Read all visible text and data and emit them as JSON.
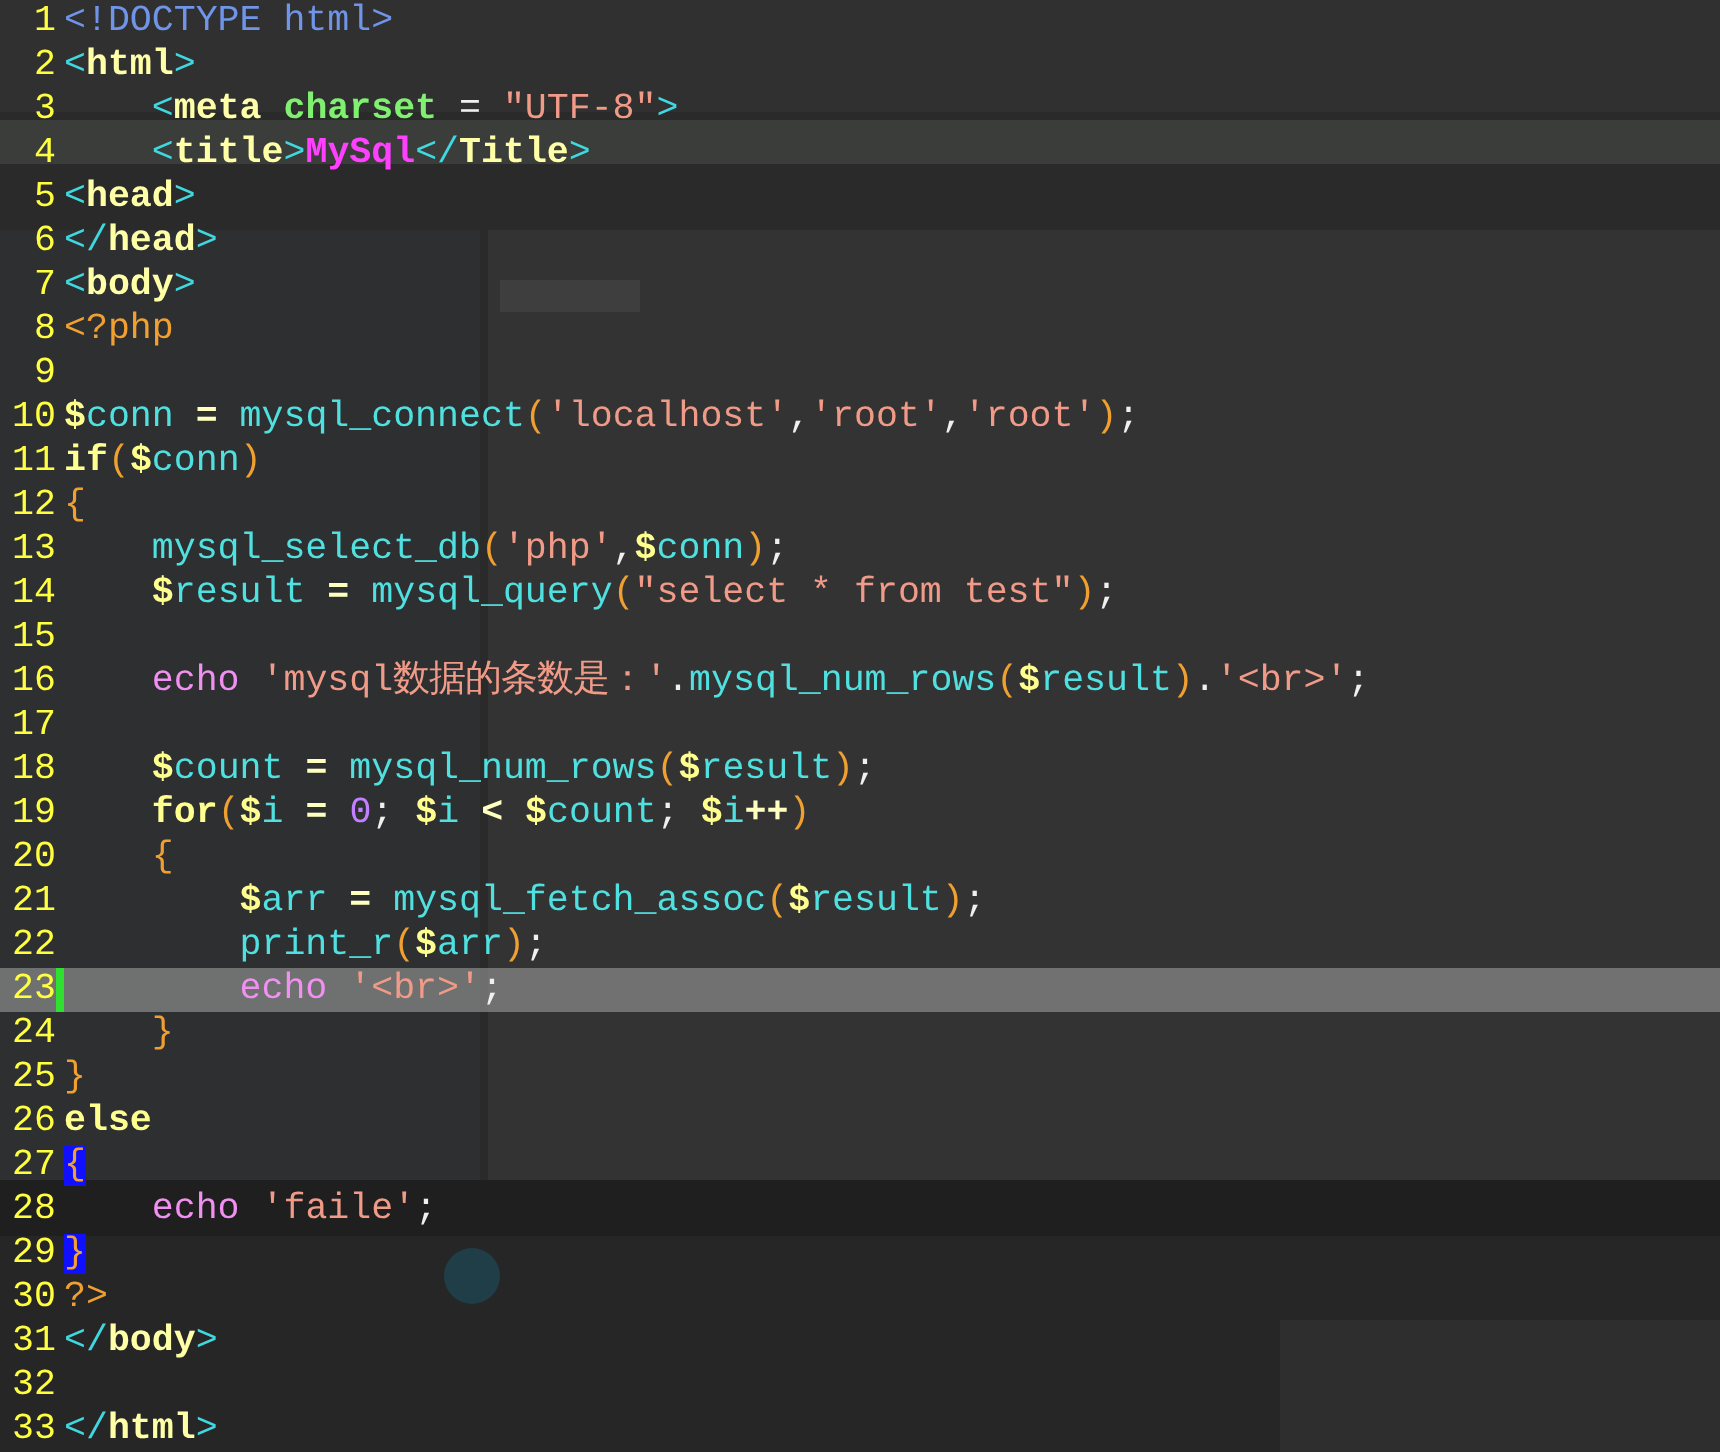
{
  "editor": {
    "lines": [
      {
        "number": "1",
        "current": false,
        "tokens": [
          {
            "kind": "doctype",
            "text": "<!DOCTYPE html>"
          }
        ]
      },
      {
        "number": "2",
        "current": false,
        "tokens": [
          {
            "kind": "bracket",
            "text": "<"
          },
          {
            "kind": "tag",
            "text": "html"
          },
          {
            "kind": "bracket",
            "text": ">"
          }
        ]
      },
      {
        "number": "3",
        "current": false,
        "tokens": [
          {
            "kind": "bracket",
            "text": "    <"
          },
          {
            "kind": "tag",
            "text": "meta "
          },
          {
            "kind": "attr",
            "text": "charset"
          },
          {
            "kind": "plain",
            "text": " = "
          },
          {
            "kind": "str",
            "text": "\"UTF-8\""
          },
          {
            "kind": "bracket",
            "text": ">"
          }
        ]
      },
      {
        "number": "4",
        "current": false,
        "tokens": [
          {
            "kind": "bracket",
            "text": "    <"
          },
          {
            "kind": "tag",
            "text": "title"
          },
          {
            "kind": "bracket",
            "text": ">"
          },
          {
            "kind": "title",
            "text": "MySql"
          },
          {
            "kind": "bracket",
            "text": "</"
          },
          {
            "kind": "tag",
            "text": "Title"
          },
          {
            "kind": "bracket",
            "text": ">"
          }
        ]
      },
      {
        "number": "5",
        "current": false,
        "tokens": [
          {
            "kind": "bracket",
            "text": "<"
          },
          {
            "kind": "tag",
            "text": "head"
          },
          {
            "kind": "bracket",
            "text": ">"
          }
        ]
      },
      {
        "number": "6",
        "current": false,
        "tokens": [
          {
            "kind": "bracket",
            "text": "</"
          },
          {
            "kind": "tag",
            "text": "head"
          },
          {
            "kind": "bracket",
            "text": ">"
          }
        ]
      },
      {
        "number": "7",
        "current": false,
        "tokens": [
          {
            "kind": "bracket",
            "text": "<"
          },
          {
            "kind": "tag",
            "text": "body"
          },
          {
            "kind": "bracket",
            "text": ">"
          }
        ]
      },
      {
        "number": "8",
        "current": false,
        "tokens": [
          {
            "kind": "php",
            "text": "<?php"
          }
        ]
      },
      {
        "number": "9",
        "current": false
      },
      {
        "number": "10",
        "current": false,
        "tokens": [
          {
            "kind": "var",
            "text": "$conn"
          },
          {
            "kind": "op",
            "text": " = "
          },
          {
            "kind": "fn",
            "text": "mysql_connect"
          },
          {
            "kind": "paren",
            "text": "("
          },
          {
            "kind": "str",
            "text": "'localhost'"
          },
          {
            "kind": "punct",
            "text": ","
          },
          {
            "kind": "str",
            "text": "'root'"
          },
          {
            "kind": "punct",
            "text": ","
          },
          {
            "kind": "str",
            "text": "'root'"
          },
          {
            "kind": "paren",
            "text": ")"
          },
          {
            "kind": "punct",
            "text": ";"
          }
        ]
      },
      {
        "number": "11",
        "current": false,
        "tokens": [
          {
            "kind": "kw",
            "text": "if"
          },
          {
            "kind": "paren",
            "text": "("
          },
          {
            "kind": "var",
            "text": "$conn"
          },
          {
            "kind": "paren",
            "text": ")"
          }
        ]
      },
      {
        "number": "12",
        "current": false,
        "tokens": [
          {
            "kind": "brace",
            "text": "{"
          }
        ]
      },
      {
        "number": "13",
        "current": false,
        "tokens": [
          {
            "kind": "fn",
            "text": "    mysql_select_db"
          },
          {
            "kind": "paren",
            "text": "("
          },
          {
            "kind": "str",
            "text": "'php'"
          },
          {
            "kind": "punct",
            "text": ","
          },
          {
            "kind": "var",
            "text": "$conn"
          },
          {
            "kind": "paren",
            "text": ")"
          },
          {
            "kind": "punct",
            "text": ";"
          }
        ]
      },
      {
        "number": "14",
        "current": false,
        "tokens": [
          {
            "kind": "var",
            "text": "    $result"
          },
          {
            "kind": "op",
            "text": " = "
          },
          {
            "kind": "fn",
            "text": "mysql_query"
          },
          {
            "kind": "paren",
            "text": "("
          },
          {
            "kind": "str",
            "text": "\"select * from test\""
          },
          {
            "kind": "paren",
            "text": ")"
          },
          {
            "kind": "punct",
            "text": ";"
          }
        ]
      },
      {
        "number": "15",
        "current": false
      },
      {
        "number": "16",
        "current": false,
        "tokens": [
          {
            "kind": "echo",
            "text": "    echo "
          },
          {
            "kind": "str",
            "text": "'mysql数据的条数是：'"
          },
          {
            "kind": "punct",
            "text": "."
          },
          {
            "kind": "fn",
            "text": "mysql_num_rows"
          },
          {
            "kind": "paren",
            "text": "("
          },
          {
            "kind": "var",
            "text": "$result"
          },
          {
            "kind": "paren",
            "text": ")"
          },
          {
            "kind": "punct",
            "text": "."
          },
          {
            "kind": "str",
            "text": "'<br>'"
          },
          {
            "kind": "punct",
            "text": ";"
          }
        ]
      },
      {
        "number": "17",
        "current": false
      },
      {
        "number": "18",
        "current": false,
        "tokens": [
          {
            "kind": "var",
            "text": "    $count"
          },
          {
            "kind": "op",
            "text": " = "
          },
          {
            "kind": "fn",
            "text": "mysql_num_rows"
          },
          {
            "kind": "paren",
            "text": "("
          },
          {
            "kind": "var",
            "text": "$result"
          },
          {
            "kind": "paren",
            "text": ")"
          },
          {
            "kind": "punct",
            "text": ";"
          }
        ]
      },
      {
        "number": "19",
        "current": false,
        "tokens": [
          {
            "kind": "kw",
            "text": "    for"
          },
          {
            "kind": "paren",
            "text": "("
          },
          {
            "kind": "var",
            "text": "$i"
          },
          {
            "kind": "op",
            "text": " = "
          },
          {
            "kind": "num",
            "text": "0"
          },
          {
            "kind": "punct",
            "text": "; "
          },
          {
            "kind": "var",
            "text": "$i"
          },
          {
            "kind": "op",
            "text": " < "
          },
          {
            "kind": "var",
            "text": "$count"
          },
          {
            "kind": "punct",
            "text": "; "
          },
          {
            "kind": "var",
            "text": "$i"
          },
          {
            "kind": "op",
            "text": "++"
          },
          {
            "kind": "paren",
            "text": ")"
          }
        ]
      },
      {
        "number": "20",
        "current": false,
        "tokens": [
          {
            "kind": "brace",
            "text": "    {"
          }
        ]
      },
      {
        "number": "21",
        "current": false,
        "tokens": [
          {
            "kind": "var",
            "text": "        $arr"
          },
          {
            "kind": "op",
            "text": " = "
          },
          {
            "kind": "fn",
            "text": "mysql_fetch_assoc"
          },
          {
            "kind": "paren",
            "text": "("
          },
          {
            "kind": "var",
            "text": "$result"
          },
          {
            "kind": "paren",
            "text": ")"
          },
          {
            "kind": "punct",
            "text": ";"
          }
        ]
      },
      {
        "number": "22",
        "current": false,
        "tokens": [
          {
            "kind": "fn",
            "text": "        print_r"
          },
          {
            "kind": "paren",
            "text": "("
          },
          {
            "kind": "var",
            "text": "$arr"
          },
          {
            "kind": "paren",
            "text": ")"
          },
          {
            "kind": "punct",
            "text": ";"
          }
        ]
      },
      {
        "number": "23",
        "current": true,
        "tokens": [
          {
            "kind": "echo",
            "text": "        echo "
          },
          {
            "kind": "str",
            "text": "'<br>'"
          },
          {
            "kind": "punct",
            "text": ";"
          }
        ]
      },
      {
        "number": "24",
        "current": false,
        "tokens": [
          {
            "kind": "brace",
            "text": "    }"
          }
        ]
      },
      {
        "number": "25",
        "current": false,
        "tokens": [
          {
            "kind": "brace",
            "text": "}"
          }
        ]
      },
      {
        "number": "26",
        "current": false,
        "tokens": [
          {
            "kind": "kw",
            "text": "else"
          }
        ]
      },
      {
        "number": "27",
        "current": false,
        "tokens": [
          {
            "kind": "brace-match",
            "text": "{"
          }
        ]
      },
      {
        "number": "28",
        "current": false,
        "tokens": [
          {
            "kind": "echo",
            "text": "    echo "
          },
          {
            "kind": "str",
            "text": "'faile'"
          },
          {
            "kind": "punct",
            "text": ";"
          }
        ]
      },
      {
        "number": "29",
        "current": false,
        "tokens": [
          {
            "kind": "brace-match",
            "text": "}"
          }
        ]
      },
      {
        "number": "30",
        "current": false,
        "tokens": [
          {
            "kind": "php",
            "text": "?>"
          }
        ]
      },
      {
        "number": "31",
        "current": false,
        "tokens": [
          {
            "kind": "bracket",
            "text": "</"
          },
          {
            "kind": "tag",
            "text": "body"
          },
          {
            "kind": "bracket",
            "text": ">"
          }
        ]
      },
      {
        "number": "32",
        "current": false
      },
      {
        "number": "33",
        "current": false,
        "tokens": [
          {
            "kind": "bracket",
            "text": "</"
          },
          {
            "kind": "tag",
            "text": "html"
          },
          {
            "kind": "bracket",
            "text": ">"
          }
        ]
      }
    ]
  }
}
